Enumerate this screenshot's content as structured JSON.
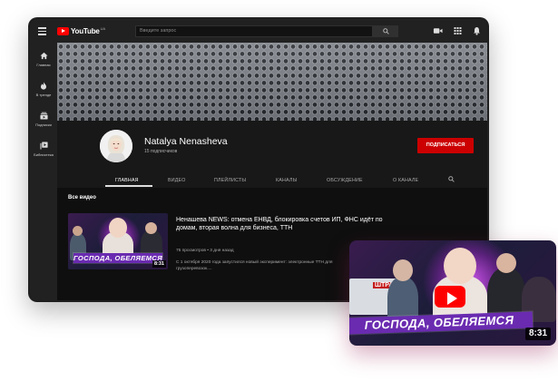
{
  "header": {
    "logo_text": "YouTube",
    "logo_region": "UA",
    "search_placeholder": "Введите запрос"
  },
  "sidebar": {
    "items": [
      {
        "label": "Главная",
        "icon": "home-icon"
      },
      {
        "label": "В тренде",
        "icon": "flame-icon"
      },
      {
        "label": "Подписки",
        "icon": "subscriptions-icon"
      },
      {
        "label": "Библиотека",
        "icon": "library-icon"
      }
    ]
  },
  "channel": {
    "name": "Natalya Nenasheva",
    "subscribers": "15 подписчиков",
    "subscribe_label": "ПОДПИСАТЬСЯ"
  },
  "tabs": [
    "ГЛАВНАЯ",
    "ВИДЕО",
    "ПЛЕЙЛИСТЫ",
    "КАНАЛЫ",
    "ОБСУЖДЕНИЕ",
    "О КАНАЛЕ"
  ],
  "content": {
    "section_title": "Все видео",
    "video": {
      "title": "Ненашева NEWS: отмена ЕНВД, блокировка счетов ИП, ФНС идёт по домам, вторая волна для бизнеса, ТТН",
      "meta": "75 просмотров • 3 дня назад",
      "description": "С 1 октября 2020 года запустился новый эксперимент: электронные ТТН для грузоперевозок....",
      "thumbnail_caption": "ГОСПОДА, ОБЕЛЯЕМСЯ",
      "duration": "8:31"
    }
  },
  "overlay_card": {
    "caption": "ГОСПОДА, ОБЕЛЯЕМСЯ",
    "duration": "8:31",
    "truck_text": "ШТРАФ"
  },
  "colors": {
    "accent_red": "#ff0000",
    "subscribe_red": "#cc0000",
    "caption_purple": "#6a2bb0"
  }
}
